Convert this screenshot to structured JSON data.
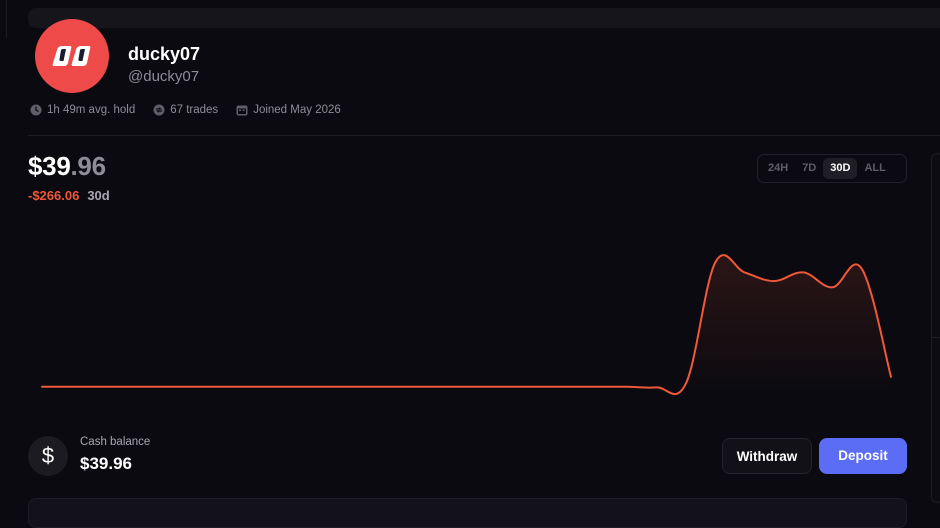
{
  "profile": {
    "username": "ducky07",
    "handle": "@ducky07",
    "avatar_color": "#ef4a4a"
  },
  "meta": [
    {
      "icon": "clock-icon",
      "text": "1h 49m avg. hold"
    },
    {
      "icon": "trades-icon",
      "text": "67 trades"
    },
    {
      "icon": "calendar-icon",
      "text": "Joined May 2026"
    }
  ],
  "portfolio": {
    "value_main": "$39",
    "value_cents": ".96",
    "change": "-$266.06",
    "period": "30d",
    "negative_color": "#f0583a"
  },
  "range_options": [
    "24H",
    "7D",
    "30D",
    "ALL"
  ],
  "range_selected": "30D",
  "chart_data": {
    "type": "line",
    "line_color": "#f0583a",
    "x": [
      0,
      1,
      2,
      3,
      4,
      5,
      6,
      7,
      8,
      9,
      10,
      11,
      12,
      13,
      14,
      15,
      16,
      17,
      18,
      19,
      20,
      21,
      22,
      23,
      24,
      25,
      26,
      27,
      28,
      29
    ],
    "values": [
      0,
      0,
      0,
      0,
      0,
      0,
      0,
      0,
      0,
      0,
      0,
      0,
      0,
      0,
      0,
      0,
      0,
      0,
      0,
      0,
      0,
      -0.5,
      3,
      100,
      92,
      85,
      92,
      80,
      95,
      8
    ],
    "ylim": [
      -5,
      110
    ],
    "grid": false
  },
  "cash": {
    "label": "Cash balance",
    "value": "$39.96",
    "icon": "dollar-icon",
    "icon_glyph": "$"
  },
  "actions": {
    "withdraw": "Withdraw",
    "deposit": "Deposit",
    "deposit_color": "#5b6cf5"
  }
}
